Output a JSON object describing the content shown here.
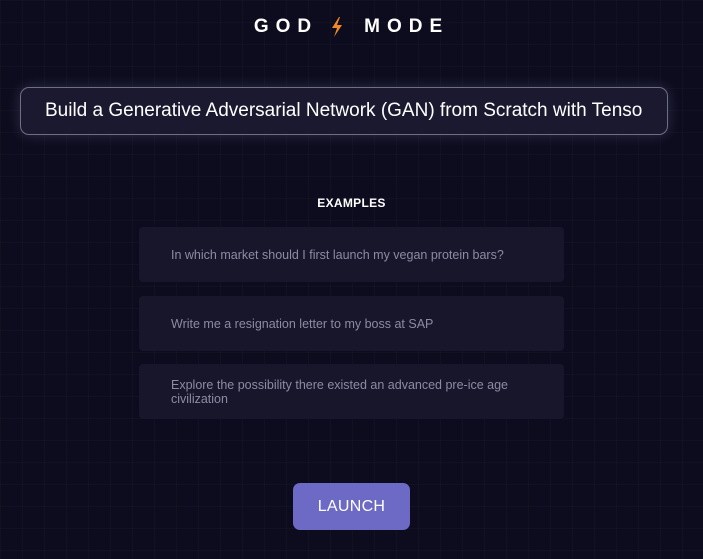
{
  "header": {
    "logo_left": "GOD",
    "logo_right": "MODE",
    "logo_icon": "lightning-bolt-icon",
    "accent_color": "#f0882a"
  },
  "prompt": {
    "value": "Build a Generative Adversarial Network (GAN) from Scratch with TensorFlow"
  },
  "examples": {
    "title": "EXAMPLES",
    "items": [
      {
        "label": "In which market should I first launch my vegan protein bars?"
      },
      {
        "label": "Write me a resignation letter to my boss at SAP"
      },
      {
        "label": "Explore the possibility there existed an advanced pre-ice age civilization"
      }
    ]
  },
  "actions": {
    "launch_label": "LAUNCH",
    "launch_color": "#6c6ac4"
  }
}
